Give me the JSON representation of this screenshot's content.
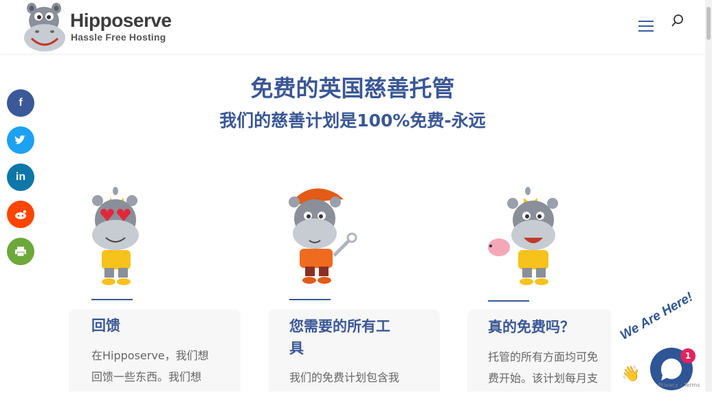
{
  "header": {
    "brand_name": "Hipposerve",
    "brand_tagline": "Hassle Free Hosting"
  },
  "hero": {
    "title": "免费的英国慈善托管",
    "subtitle": "我们的慈善计划是100%免费-永远"
  },
  "social": [
    {
      "label": "f",
      "icon": "facebook-icon",
      "color": "#3b5998"
    },
    {
      "label": "t",
      "icon": "twitter-icon",
      "color": "#1da1f2"
    },
    {
      "label": "in",
      "icon": "linkedin-icon",
      "color": "#0e76a8"
    },
    {
      "label": "r",
      "icon": "reddit-icon",
      "color": "#ff4500"
    },
    {
      "label": "p",
      "icon": "print-icon",
      "color": "#6ca83a"
    }
  ],
  "columns": [
    {
      "title": "回馈",
      "text_lines": [
        "在Hipposerve，我们想",
        "回馈一些东西。我们想"
      ]
    },
    {
      "title_lines": [
        "您需要的所有工",
        "具"
      ],
      "text_lines": [
        "我们的免费计划包含我"
      ]
    },
    {
      "title": "真的免费吗？",
      "text_lines": [
        "托管的所有方面均可免",
        "费开始。该计划每月支"
      ]
    }
  ],
  "chat": {
    "greeting": "We Are Here!",
    "badge": "1"
  },
  "recaptcha": "Privacy - Terms"
}
